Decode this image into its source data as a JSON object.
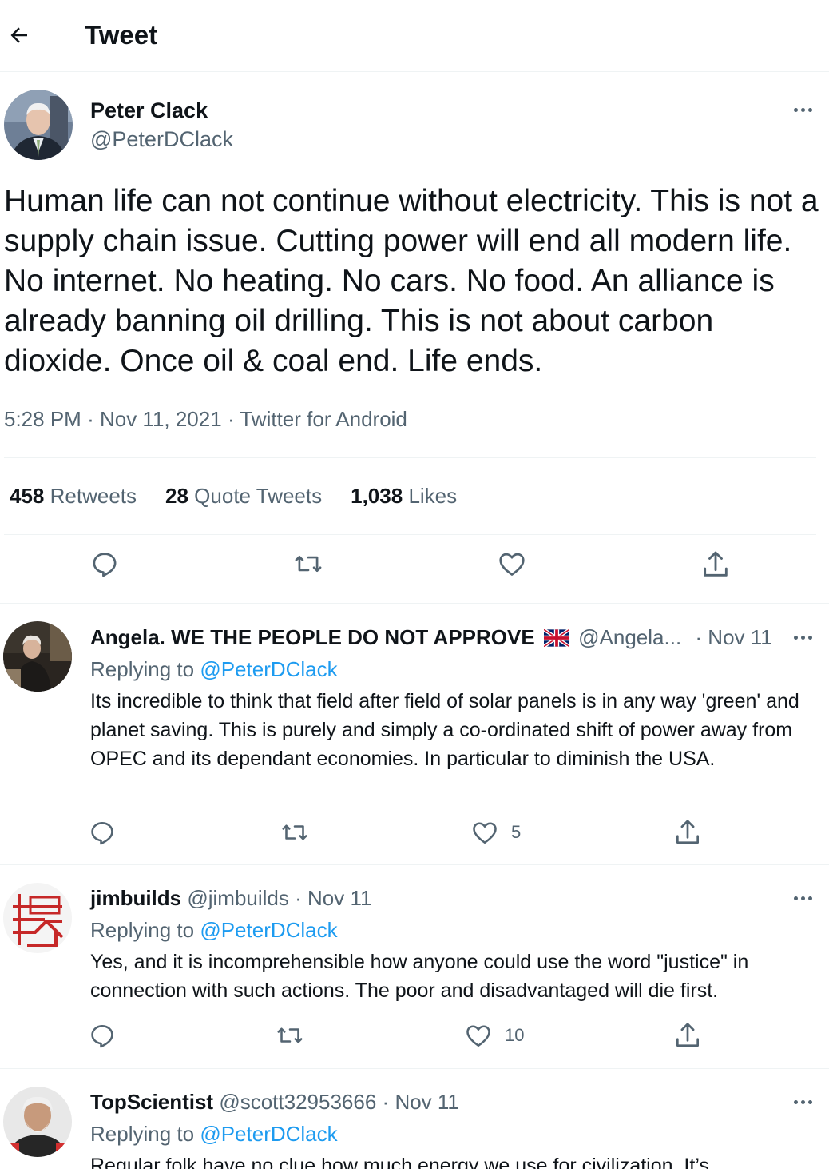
{
  "header": {
    "title": "Tweet"
  },
  "main_tweet": {
    "author_name": "Peter Clack",
    "author_handle": "@PeterDClack",
    "text": "Human life can not continue without electricity. This is not a supply chain issue. Cutting power will end all modern life. No internet. No heating. No cars. No food. An alliance is already banning oil drilling. This is not about carbon dioxide. Once oil & coal end. Life ends.",
    "time": "5:28 PM",
    "date": "Nov 11, 2021",
    "source": "Twitter for Android",
    "stats": {
      "retweets_count": "458",
      "retweets_label": "Retweets",
      "quotes_count": "28",
      "quotes_label": "Quote Tweets",
      "likes_count": "1,038",
      "likes_label": "Likes"
    }
  },
  "replies": [
    {
      "name": "Angela. WE THE PEOPLE DO NOT APPROVE",
      "handle": "@Angela...",
      "date": "Nov 11",
      "replying_label": "Replying to",
      "replying_to": "@PeterDClack",
      "text": "Its incredible to think that field after field of solar panels is in any way 'green' and planet saving. This is purely and simply a co-ordinated shift of power away from OPEC and its dependant economies. In particular to diminish the USA.",
      "likes": "5"
    },
    {
      "name": "jimbuilds",
      "handle": "@jimbuilds",
      "date": "Nov 11",
      "replying_label": "Replying to",
      "replying_to": "@PeterDClack",
      "text": "Yes, and it is incomprehensible how anyone could use the word \"justice\" in connection with such actions. The poor and disadvantaged will die first.",
      "likes": "10"
    },
    {
      "name": "TopScientist",
      "handle": "@scott32953666",
      "date": "Nov 11",
      "replying_label": "Replying to",
      "replying_to": "@PeterDClack",
      "text": "Regular folk have no clue how much energy we use for civilization. It’s"
    }
  ],
  "colors": {
    "text": "#0f1419",
    "secondary": "#536471",
    "link": "#1d9bf0",
    "border": "#eff3f4"
  },
  "icons": [
    "back-arrow-icon",
    "more-icon",
    "reply-icon",
    "retweet-icon",
    "like-icon",
    "share-icon",
    "uk-flag-icon"
  ]
}
